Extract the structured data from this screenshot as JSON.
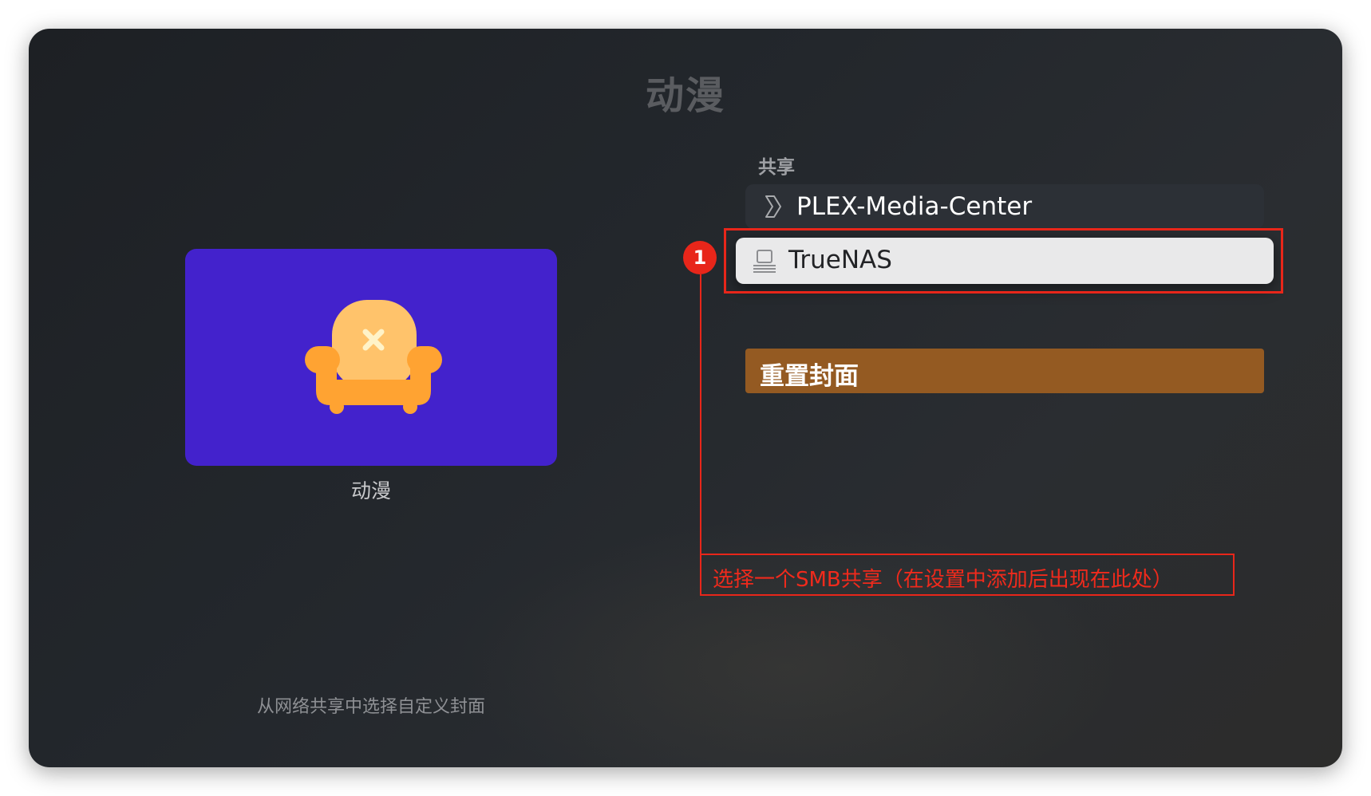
{
  "header": {
    "title": "动漫"
  },
  "cover": {
    "label": "动漫",
    "background_color": "#4322cc",
    "icon": "armchair-icon"
  },
  "shares": {
    "section_label": "共享",
    "items": [
      {
        "label": "PLEX-Media-Center",
        "icon": "chevron-right-icon",
        "selected": false
      },
      {
        "label": "TrueNAS",
        "icon": "network-drive-icon",
        "selected": true
      }
    ]
  },
  "actions": {
    "reset_cover_label": "重置封面",
    "reset_color": "#945a22"
  },
  "footer": {
    "hint": "从网络共享中选择自定义封面"
  },
  "annotation": {
    "badge": "1",
    "callout": "选择一个SMB共享（在设置中添加后出现在此处）",
    "color": "#e8261a"
  }
}
